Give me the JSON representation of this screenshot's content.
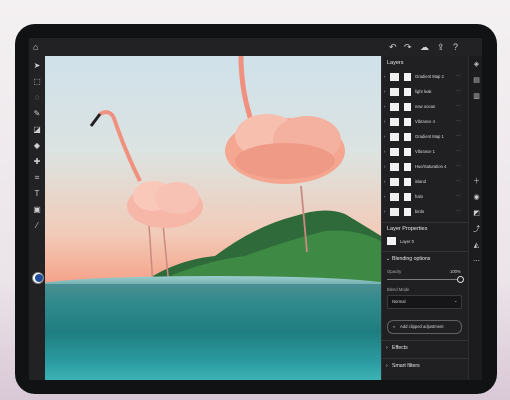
{
  "topbar": {
    "home_icon": "home-icon",
    "undo_icon": "undo-icon",
    "redo_icon": "redo-icon",
    "cloud_icon": "cloud-icon",
    "share_icon": "share-icon",
    "help_icon": "help-icon"
  },
  "tools": [
    "move-tool-icon",
    "select-tool-icon",
    "lasso-tool-icon",
    "brush-tool-icon",
    "eraser-tool-icon",
    "fill-tool-icon",
    "healing-tool-icon",
    "crop-tool-icon",
    "type-tool-icon",
    "image-tool-icon",
    "eyedropper-tool-icon"
  ],
  "layers_panel": {
    "title": "Layers",
    "layers": [
      {
        "name": "Gradient Map 2",
        "selected": false
      },
      {
        "name": "light leak",
        "selected": false
      },
      {
        "name": "new ocean",
        "selected": false
      },
      {
        "name": "Vibrance 4",
        "selected": false
      },
      {
        "name": "Gradient Map 1",
        "selected": false
      },
      {
        "name": "Vibrance 1",
        "selected": false
      },
      {
        "name": "Hue/Saturation 4",
        "selected": false
      },
      {
        "name": "island",
        "selected": false
      },
      {
        "name": "halo",
        "selected": false
      },
      {
        "name": "birds",
        "selected": false
      }
    ]
  },
  "layer_properties": {
    "title": "Layer Properties",
    "layer_name": "Layer 0"
  },
  "blending": {
    "title": "Blending options",
    "opacity_label": "Opacity",
    "opacity_value": "100%",
    "opacity_fraction": 1.0,
    "blend_mode_label": "Blend Mode",
    "blend_mode_value": "Normal",
    "clipped_button": "Add clipped adjustment"
  },
  "effects": {
    "title": "Effects"
  },
  "smart_filters": {
    "title": "Smart filters"
  },
  "colors": {
    "accent": "#2f6fd8",
    "panel": "#202022",
    "toolbar": "#222224"
  }
}
